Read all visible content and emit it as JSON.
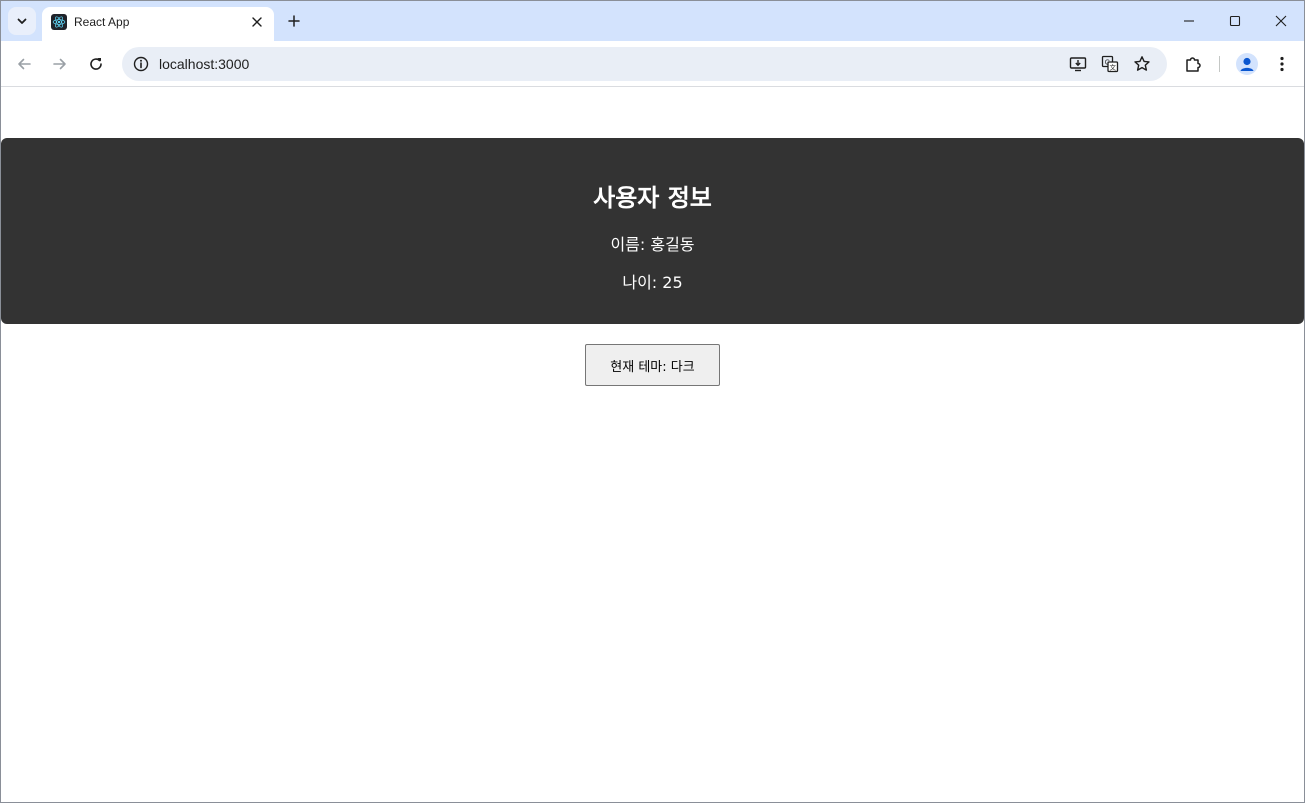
{
  "browser": {
    "tab": {
      "title": "React App"
    },
    "url": "localhost:3000"
  },
  "page": {
    "card": {
      "title": "사용자 정보",
      "name_line": "이름: 홍길동",
      "age_line": "나이: 25"
    },
    "theme_button": "현재 테마: 다크"
  },
  "colors": {
    "tabstrip": "#d3e3fd",
    "card_bg": "#333333",
    "card_text": "#ffffff",
    "react_cyan": "#61dafb"
  }
}
